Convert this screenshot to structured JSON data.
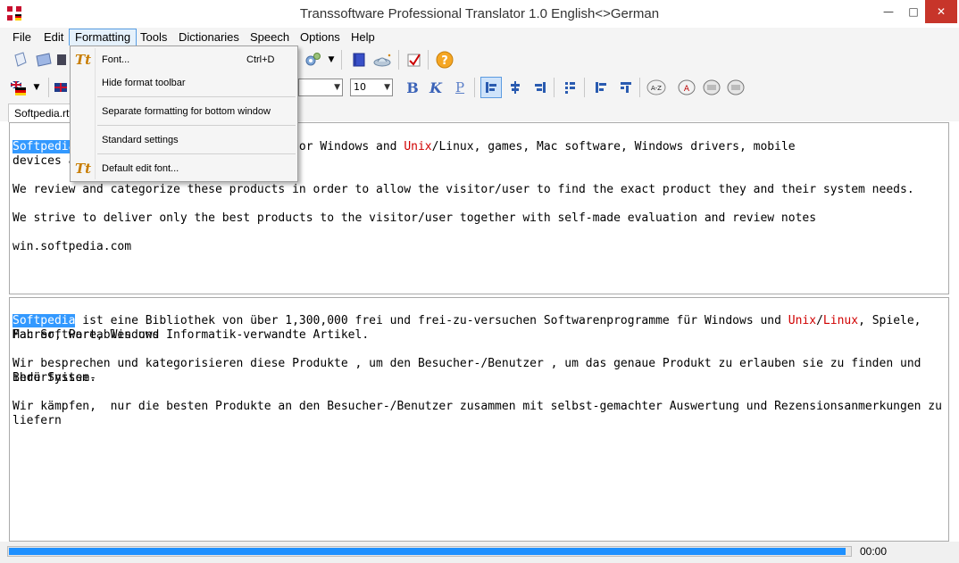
{
  "window": {
    "title": "Transsoftware Professional Translator 1.0 English<>German",
    "min_glyph": "—",
    "max_glyph": "□",
    "close_glyph": "✕"
  },
  "menu": [
    "File",
    "Edit",
    "Formatting",
    "Tools",
    "Dictionaries",
    "Speech",
    "Options",
    "Help"
  ],
  "format_toolbar": {
    "font_size": "10",
    "bold": "B",
    "italic": "K",
    "underline": "P"
  },
  "document_tab": "Softpedia.rtf",
  "formatting_menu": {
    "items": [
      {
        "label": "Font...",
        "shortcut": "Ctrl+D",
        "icon": "font-icon"
      },
      {
        "label": "Hide format toolbar",
        "shortcut": ""
      },
      {
        "label": "Separate formatting for bottom window",
        "shortcut": ""
      },
      {
        "label": "Standard settings",
        "shortcut": ""
      },
      {
        "label": "Default edit font...",
        "shortcut": "",
        "icon": "font-icon"
      }
    ]
  },
  "source_pane": {
    "p1_highlight": "Softpedia",
    "p1_mid": " free-to-try software programs for Windows and ",
    "p1_red": "Unix",
    "p1_end": "/Linux, games, Mac software, Windows drivers, mobile",
    "p1_line2": "devices a",
    "p2": "We review and categorize these products in order to allow the visitor/user to find the exact product they and their system needs.",
    "p3": "We strive to deliver only the best products to the visitor/user together with self-made evaluation and review notes",
    "p4": "win.softpedia.com"
  },
  "target_pane": {
    "p1_highlight": "Softpedia",
    "p1_mid": " ist eine Bibliothek von über 1,300,000 frei und frei-zu-versuchen Softwarenprogramme für Windows und ",
    "p1_red1": "Unix",
    "p1_slash": "/",
    "p1_red2": "Linux",
    "p1_end": ", Spiele, Mac Software, Windows",
    "p1_line2": "Fahrer, Portables und Informatik-verwandte Artikel.",
    "p2_line1": "Wir besprechen und kategorisieren diese Produkte , um den Besucher-/Benutzer , um das genaue Produkt zu erlauben sie zu finden und ihre System-",
    "p2_line2": "Bedürfnisse.",
    "p3": "Wir kämpfen,  nur die besten Produkte an den Besucher-/Benutzer zusammen mit selbst-gemachter Auswertung und Rezensionsanmerkungen zu liefern"
  },
  "status": {
    "progress": 0.995,
    "time": "00:00"
  },
  "colors": {
    "highlight": "#3399ff",
    "red_text": "#d00000",
    "progress": "#1e90ff",
    "close": "#c7352a"
  }
}
